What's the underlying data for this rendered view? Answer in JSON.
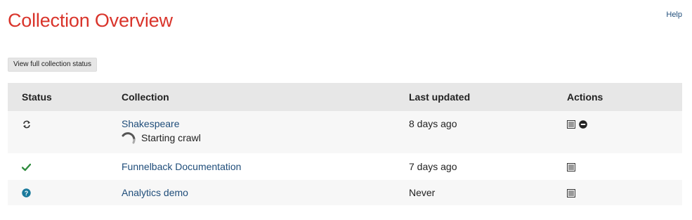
{
  "header": {
    "title": "Collection Overview",
    "help_label": "Help"
  },
  "toolbar": {
    "view_status_label": "View full collection status"
  },
  "table": {
    "columns": [
      "Status",
      "Collection",
      "Last updated",
      "Actions"
    ],
    "rows": [
      {
        "status_icon": "refresh-icon",
        "collection": "Shakespeare",
        "substatus": "Starting crawl",
        "last_updated": "8 days ago",
        "actions": [
          "log-icon",
          "stop-icon"
        ]
      },
      {
        "status_icon": "check-icon",
        "collection": "Funnelback Documentation",
        "last_updated": "7 days ago",
        "actions": [
          "log-icon"
        ]
      },
      {
        "status_icon": "question-icon",
        "collection": "Analytics demo",
        "last_updated": "Never",
        "actions": [
          "log-icon"
        ]
      }
    ]
  },
  "colors": {
    "title": "#d9342b",
    "link": "#1f4d7a",
    "success": "#2e8b3d",
    "info": "#1a7a9c"
  }
}
